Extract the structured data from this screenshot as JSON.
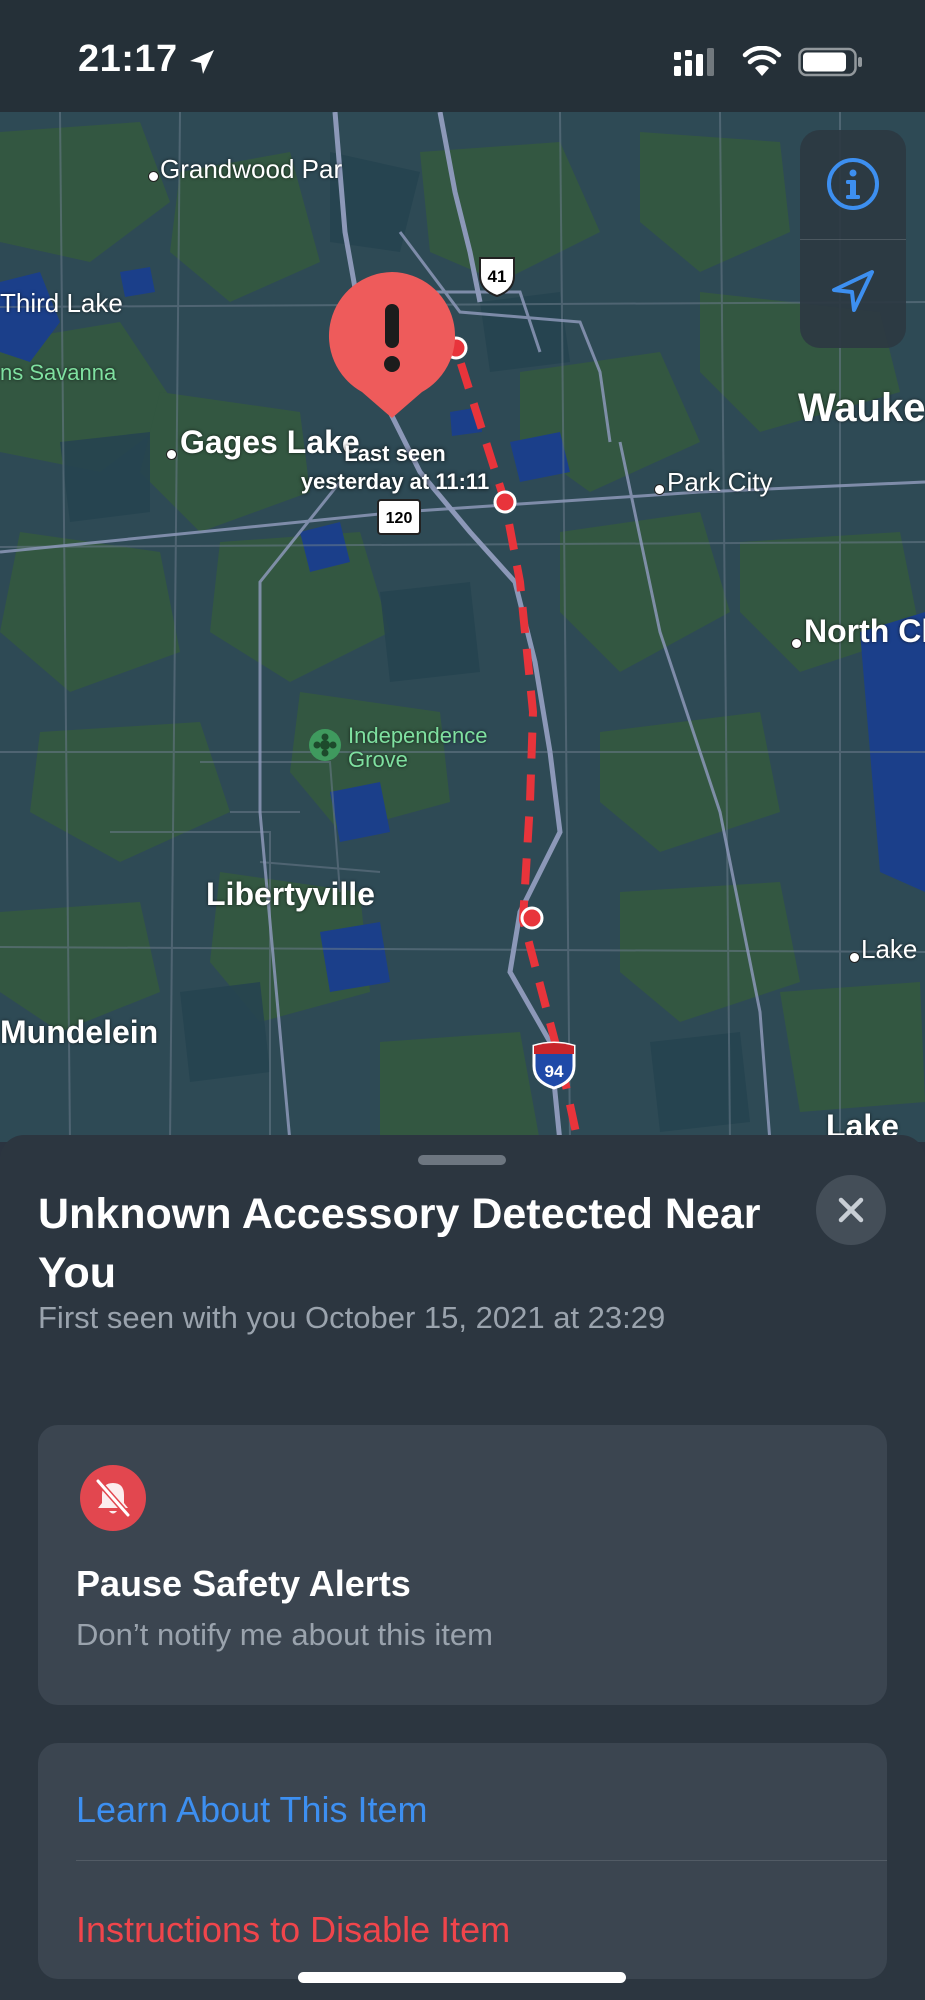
{
  "status_bar": {
    "time": "21:17",
    "icons": [
      "location-arrow-icon",
      "cellular-signal-icon",
      "wifi-icon",
      "battery-icon"
    ]
  },
  "map": {
    "labels": {
      "grandwood_park": "Grandwood Par",
      "third_lake": "Third Lake",
      "savanna": "ns Savanna",
      "gages_lake": "Gages Lake",
      "park_city": "Park City",
      "wauke": "Wauke",
      "north_ch": "North Ch",
      "independence_grove": "Independence\nGrove",
      "libertyville": "Libertyville",
      "mundelein": "Mundelein",
      "lake_right": "Lake",
      "lake_bottom": "Lake"
    },
    "shields": {
      "us_41": "41",
      "il_120": "120",
      "i_94": "94"
    },
    "last_seen": "Last seen\nyesterday at 11:11",
    "controls": [
      "info-icon",
      "location-arrow-icon"
    ],
    "colors": {
      "route": "#e8343b",
      "pin": "#ee5b5b",
      "accent": "#3d8ff0"
    }
  },
  "sheet": {
    "title": "Unknown Accessory Detected Near You",
    "subtitle": "First seen with you October 15, 2021 at 23:29",
    "pause_card": {
      "icon": "bell-slash-icon",
      "title": "Pause Safety Alerts",
      "subtitle": "Don’t notify me about this item"
    },
    "links": {
      "learn": "Learn About This Item",
      "disable": "Instructions to Disable Item"
    },
    "colors": {
      "learn": "#3d8ff0",
      "disable": "#f0454b",
      "bell_bg": "#e2474f"
    }
  }
}
